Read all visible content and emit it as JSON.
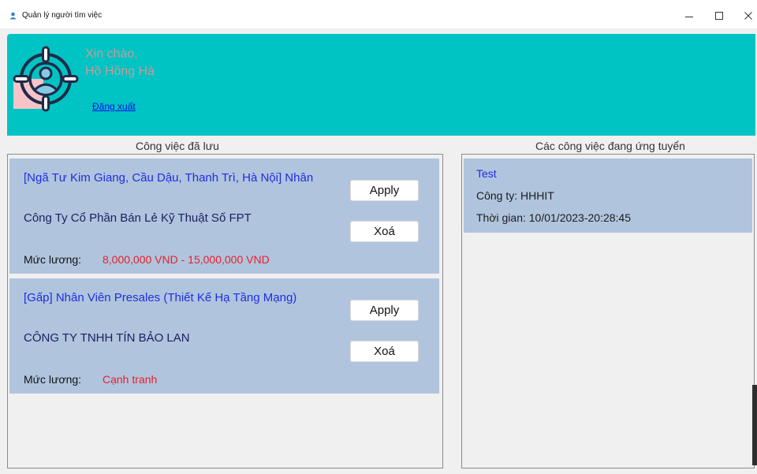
{
  "window": {
    "title": "Quản lý người tìm việc",
    "app_icon": "user-icon",
    "controls": [
      "minimize-icon",
      "maximize-icon",
      "close-icon"
    ]
  },
  "header": {
    "avatar_icon": "target-user-icon",
    "greeting": "Xin chào,",
    "user_name": "Hồ Hồng Hà",
    "logout_label": "Đăng xuất"
  },
  "saved_jobs": {
    "heading": "Công việc đã lưu",
    "items": [
      {
        "title": "[Ngã Tư Kim Giang, Cầu Dậu, Thanh Trì, Hà Nội] Nhân",
        "company": "Công Ty Cổ Phần Bán Lẻ Kỹ Thuật Số FPT",
        "salary_label": "Mức lương:",
        "salary": "8,000,000 VND - 15,000,000 VND",
        "apply_label": "Apply",
        "delete_label": "Xoá"
      },
      {
        "title": "[Gấp] Nhân Viên Presales (Thiết Kế Hạ Tầng Mạng)",
        "company": "CÔNG TY TNHH TÍN BẢO LAN",
        "salary_label": "Mức lương:",
        "salary": "Cạnh tranh",
        "apply_label": "Apply",
        "delete_label": "Xoá"
      }
    ]
  },
  "applied_jobs": {
    "heading": "Các công việc đang ứng tuyển",
    "items": [
      {
        "title": "Test",
        "company": "Công ty: HHHIT",
        "time": "Thời gian: 10/01/2023-20:28:45"
      }
    ]
  },
  "colors": {
    "header_bg": "#00C3C3",
    "card_bg": "#B0C4DE",
    "title_blue": "#1E2FE0",
    "company_color": "#1B1F5E",
    "salary_red": "#E8202A",
    "greeting": "#C69C9C",
    "link": "#0A0AEE"
  }
}
